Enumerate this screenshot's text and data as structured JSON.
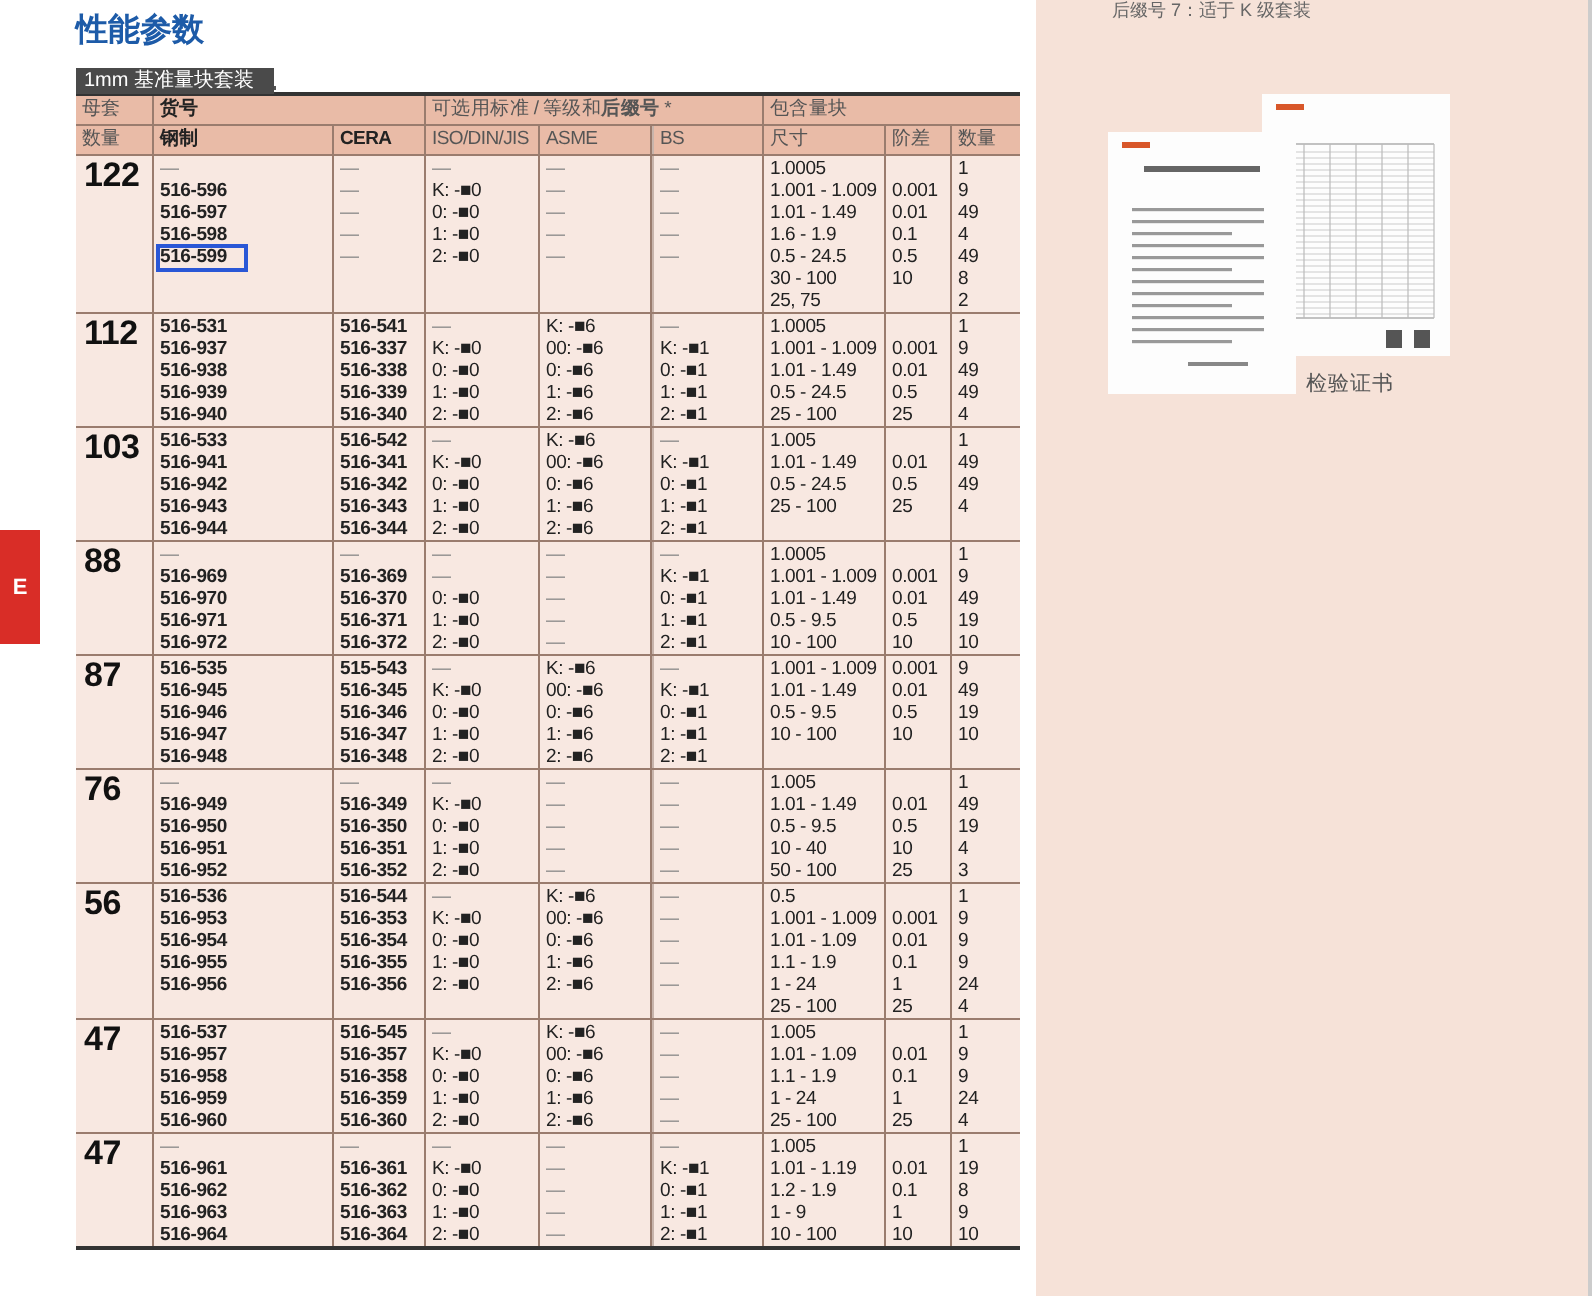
{
  "title": "性能参数",
  "subtitle": "1mm 基准量块套装",
  "table": {
    "header": {
      "count_top": "母套",
      "count_bottom": "数量",
      "part_no": "货号",
      "standards": "可选用标准 / 等级和**后缀号** *",
      "included": "包含量块",
      "steel": "钢制",
      "cera": "CERA",
      "iso": "ISO/DIN/JIS",
      "asme": "ASME",
      "bs": "BS",
      "size": "尺寸",
      "step": "阶差",
      "qty": "数量"
    },
    "groups": [
      {
        "count": "122",
        "parts": [
          {
            "steel": "—",
            "cera": "—",
            "iso": "—",
            "asme": "—",
            "bs": "—",
            "outlined": false
          },
          {
            "steel": "516-596",
            "cera": "—",
            "iso": "K: -■0",
            "asme": "—",
            "bs": "—",
            "outlined": false
          },
          {
            "steel": "516-597",
            "cera": "—",
            "iso": "0: -■0",
            "asme": "—",
            "bs": "—",
            "outlined": false
          },
          {
            "steel": "516-598",
            "cera": "—",
            "iso": "1: -■0",
            "asme": "—",
            "bs": "—",
            "outlined": false
          },
          {
            "steel": "516-599",
            "cera": "—",
            "iso": "2: -■0",
            "asme": "—",
            "bs": "—",
            "outlined": true
          }
        ],
        "blocks": [
          {
            "size": "1.0005",
            "qty": "1"
          },
          {
            "size": "1.001 - 1.009",
            "step": "0.001",
            "qty": "9"
          },
          {
            "size": "1.01 - 1.49",
            "step": "0.01",
            "qty": "49"
          },
          {
            "size": "1.6 - 1.9",
            "step": "0.1",
            "qty": "4"
          },
          {
            "size": "0.5 - 24.5",
            "step": "0.5",
            "qty": "49"
          },
          {
            "size": "30 - 100",
            "step": "10",
            "qty": "8"
          },
          {
            "size": "25, 75",
            "qty": "2"
          }
        ]
      },
      {
        "count": "112",
        "parts": [
          {
            "steel": "516-531",
            "cera": "516-541",
            "iso": "—",
            "asme": "K: -■6",
            "bs": "—",
            "outlined": false
          },
          {
            "steel": "516-937",
            "cera": "516-337",
            "iso": "K: -■0",
            "asme": "00: -■6",
            "bs": "K: -■1",
            "outlined": false
          },
          {
            "steel": "516-938",
            "cera": "516-338",
            "iso": "0: -■0",
            "asme": "0: -■6",
            "bs": "0: -■1",
            "outlined": false
          },
          {
            "steel": "516-939",
            "cera": "516-339",
            "iso": "1: -■0",
            "asme": "1: -■6",
            "bs": "1: -■1",
            "outlined": false
          },
          {
            "steel": "516-940",
            "cera": "516-340",
            "iso": "2: -■0",
            "asme": "2: -■6",
            "bs": "2: -■1",
            "outlined": false
          }
        ],
        "blocks": [
          {
            "size": "1.0005",
            "qty": "1"
          },
          {
            "size": "1.001 - 1.009",
            "step": "0.001",
            "qty": "9"
          },
          {
            "size": "1.01 - 1.49",
            "step": "0.01",
            "qty": "49"
          },
          {
            "size": "0.5 - 24.5",
            "step": "0.5",
            "qty": "49"
          },
          {
            "size": "25 - 100",
            "step": "25",
            "qty": "4"
          }
        ]
      },
      {
        "count": "103",
        "parts": [
          {
            "steel": "516-533",
            "cera": "516-542",
            "iso": "—",
            "asme": "K: -■6",
            "bs": "—",
            "outlined": false
          },
          {
            "steel": "516-941",
            "cera": "516-341",
            "iso": "K: -■0",
            "asme": "00: -■6",
            "bs": "K: -■1",
            "outlined": false
          },
          {
            "steel": "516-942",
            "cera": "516-342",
            "iso": "0: -■0",
            "asme": "0: -■6",
            "bs": "0: -■1",
            "outlined": false
          },
          {
            "steel": "516-943",
            "cera": "516-343",
            "iso": "1: -■0",
            "asme": "1: -■6",
            "bs": "1: -■1",
            "outlined": false
          },
          {
            "steel": "516-944",
            "cera": "516-344",
            "iso": "2: -■0",
            "asme": "2: -■6",
            "bs": "2: -■1",
            "outlined": false
          }
        ],
        "blocks": [
          {
            "size": "1.005",
            "qty": "1"
          },
          {
            "size": "1.01 - 1.49",
            "step": "0.01",
            "qty": "49"
          },
          {
            "size": "0.5 - 24.5",
            "step": "0.5",
            "qty": "49"
          },
          {
            "size": "25 - 100",
            "step": "25",
            "qty": "4"
          }
        ]
      },
      {
        "count": "88",
        "parts": [
          {
            "steel": "—",
            "cera": "—",
            "iso": "—",
            "asme": "—",
            "bs": "—",
            "outlined": false
          },
          {
            "steel": "516-969",
            "cera": "516-369",
            "iso": "—",
            "asme": "—",
            "bs": "K: -■1",
            "outlined": false
          },
          {
            "steel": "516-970",
            "cera": "516-370",
            "iso": "0: -■0",
            "asme": "—",
            "bs": "0: -■1",
            "outlined": false
          },
          {
            "steel": "516-971",
            "cera": "516-371",
            "iso": "1: -■0",
            "asme": "—",
            "bs": "1: -■1",
            "outlined": false
          },
          {
            "steel": "516-972",
            "cera": "516-372",
            "iso": "2: -■0",
            "asme": "—",
            "bs": "2: -■1",
            "outlined": false
          }
        ],
        "blocks": [
          {
            "size": "1.0005",
            "qty": "1"
          },
          {
            "size": "1.001 - 1.009",
            "step": "0.001",
            "qty": "9"
          },
          {
            "size": "1.01 - 1.49",
            "step": "0.01",
            "qty": "49"
          },
          {
            "size": "0.5 - 9.5",
            "step": "0.5",
            "qty": "19"
          },
          {
            "size": "10 - 100",
            "step": "10",
            "qty": "10"
          }
        ]
      },
      {
        "count": "87",
        "parts": [
          {
            "steel": "516-535",
            "cera": "515-543",
            "iso": "—",
            "asme": "K: -■6",
            "bs": "—",
            "outlined": false
          },
          {
            "steel": "516-945",
            "cera": "516-345",
            "iso": "K: -■0",
            "asme": "00: -■6",
            "bs": "K: -■1",
            "outlined": false
          },
          {
            "steel": "516-946",
            "cera": "516-346",
            "iso": "0: -■0",
            "asme": "0: -■6",
            "bs": "0: -■1",
            "outlined": false
          },
          {
            "steel": "516-947",
            "cera": "516-347",
            "iso": "1: -■0",
            "asme": "1: -■6",
            "bs": "1: -■1",
            "outlined": false
          },
          {
            "steel": "516-948",
            "cera": "516-348",
            "iso": "2: -■0",
            "asme": "2: -■6",
            "bs": "2: -■1",
            "outlined": false
          }
        ],
        "blocks": [
          {
            "size": "1.001 - 1.009",
            "step": "0.001",
            "qty": "9"
          },
          {
            "size": "1.01 - 1.49",
            "step": "0.01",
            "qty": "49"
          },
          {
            "size": "0.5 - 9.5",
            "step": "0.5",
            "qty": "19"
          },
          {
            "size": "10 - 100",
            "step": "10",
            "qty": "10"
          }
        ]
      },
      {
        "count": "76",
        "parts": [
          {
            "steel": "—",
            "cera": "—",
            "iso": "—",
            "asme": "—",
            "bs": "—",
            "outlined": false
          },
          {
            "steel": "516-949",
            "cera": "516-349",
            "iso": "K: -■0",
            "asme": "—",
            "bs": "—",
            "outlined": false
          },
          {
            "steel": "516-950",
            "cera": "516-350",
            "iso": "0: -■0",
            "asme": "—",
            "bs": "—",
            "outlined": false
          },
          {
            "steel": "516-951",
            "cera": "516-351",
            "iso": "1: -■0",
            "asme": "—",
            "bs": "—",
            "outlined": false
          },
          {
            "steel": "516-952",
            "cera": "516-352",
            "iso": "2: -■0",
            "asme": "—",
            "bs": "—",
            "outlined": false
          }
        ],
        "blocks": [
          {
            "size": "1.005",
            "qty": "1"
          },
          {
            "size": "1.01 - 1.49",
            "step": "0.01",
            "qty": "49"
          },
          {
            "size": "0.5 - 9.5",
            "step": "0.5",
            "qty": "19"
          },
          {
            "size": "10 - 40",
            "step": "10",
            "qty": "4"
          },
          {
            "size": "50 - 100",
            "step": "25",
            "qty": "3"
          }
        ]
      },
      {
        "count": "56",
        "parts": [
          {
            "steel": "516-536",
            "cera": "516-544",
            "iso": "—",
            "asme": "K: -■6",
            "bs": "—",
            "outlined": false
          },
          {
            "steel": "516-953",
            "cera": "516-353",
            "iso": "K: -■0",
            "asme": "00: -■6",
            "bs": "—",
            "outlined": false
          },
          {
            "steel": "516-954",
            "cera": "516-354",
            "iso": "0: -■0",
            "asme": "0: -■6",
            "bs": "—",
            "outlined": false
          },
          {
            "steel": "516-955",
            "cera": "516-355",
            "iso": "1: -■0",
            "asme": "1: -■6",
            "bs": "—",
            "outlined": false
          },
          {
            "steel": "516-956",
            "cera": "516-356",
            "iso": "2: -■0",
            "asme": "2: -■6",
            "bs": "—",
            "outlined": false
          }
        ],
        "blocks": [
          {
            "size": "0.5",
            "qty": "1"
          },
          {
            "size": "1.001 - 1.009",
            "step": "0.001",
            "qty": "9"
          },
          {
            "size": "1.01 - 1.09",
            "step": "0.01",
            "qty": "9"
          },
          {
            "size": "1.1 - 1.9",
            "step": "0.1",
            "qty": "9"
          },
          {
            "size": "1 - 24",
            "step": "1",
            "qty": "24"
          },
          {
            "size": "25 - 100",
            "step": "25",
            "qty": "4"
          }
        ]
      },
      {
        "count": "47",
        "parts": [
          {
            "steel": "516-537",
            "cera": "516-545",
            "iso": "—",
            "asme": "K: -■6",
            "bs": "—",
            "outlined": false
          },
          {
            "steel": "516-957",
            "cera": "516-357",
            "iso": "K: -■0",
            "asme": "00: -■6",
            "bs": "—",
            "outlined": false
          },
          {
            "steel": "516-958",
            "cera": "516-358",
            "iso": "0: -■0",
            "asme": "0: -■6",
            "bs": "—",
            "outlined": false
          },
          {
            "steel": "516-959",
            "cera": "516-359",
            "iso": "1: -■0",
            "asme": "1: -■6",
            "bs": "—",
            "outlined": false
          },
          {
            "steel": "516-960",
            "cera": "516-360",
            "iso": "2: -■0",
            "asme": "2: -■6",
            "bs": "—",
            "outlined": false
          }
        ],
        "blocks": [
          {
            "size": "1.005",
            "qty": "1"
          },
          {
            "size": "1.01 - 1.09",
            "step": "0.01",
            "qty": "9"
          },
          {
            "size": "1.1 - 1.9",
            "step": "0.1",
            "qty": "9"
          },
          {
            "size": "1 - 24",
            "step": "1",
            "qty": "24"
          },
          {
            "size": "25 - 100",
            "step": "25",
            "qty": "4"
          }
        ]
      },
      {
        "count": "47",
        "parts": [
          {
            "steel": "—",
            "cera": "—",
            "iso": "—",
            "asme": "—",
            "bs": "—",
            "outlined": false
          },
          {
            "steel": "516-961",
            "cera": "516-361",
            "iso": "K: -■0",
            "asme": "—",
            "bs": "K: -■1",
            "outlined": false
          },
          {
            "steel": "516-962",
            "cera": "516-362",
            "iso": "0: -■0",
            "asme": "—",
            "bs": "0: -■1",
            "outlined": false
          },
          {
            "steel": "516-963",
            "cera": "516-363",
            "iso": "1: -■0",
            "asme": "—",
            "bs": "1: -■1",
            "outlined": false
          },
          {
            "steel": "516-964",
            "cera": "516-364",
            "iso": "2: -■0",
            "asme": "—",
            "bs": "2: -■1",
            "outlined": false
          }
        ],
        "blocks": [
          {
            "size": "1.005",
            "qty": "1"
          },
          {
            "size": "1.01 - 1.19",
            "step": "0.01",
            "qty": "19"
          },
          {
            "size": "1.2 - 1.9",
            "step": "0.1",
            "qty": "8"
          },
          {
            "size": "1 - 9",
            "step": "1",
            "qty": "9"
          },
          {
            "size": "10 - 100",
            "step": "10",
            "qty": "10"
          }
        ]
      }
    ]
  },
  "side_tab": "E",
  "side_panel": {
    "note": "后缀号 7：适于 K 级套装",
    "caption": "检验证书"
  }
}
